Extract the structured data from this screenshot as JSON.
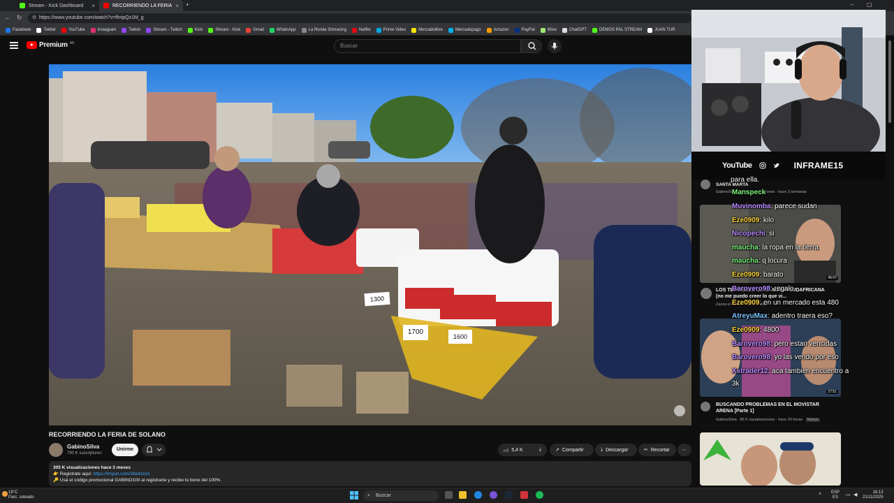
{
  "browser": {
    "tabs": [
      {
        "label": "Stream - Kick Dashboard",
        "active": false
      },
      {
        "label": "RECORRIENDO LA FERIA DE SOL...",
        "active": true
      }
    ],
    "url": "https://www.youtube.com/watch?v=fhripQz1M_g",
    "bookmarks": [
      {
        "label": "Facebook",
        "color": "#1877f2"
      },
      {
        "label": "Twitter",
        "color": "#ffffff"
      },
      {
        "label": "YouTube",
        "color": "#ff0000"
      },
      {
        "label": "Instagram",
        "color": "#e1306c"
      },
      {
        "label": "Twitch",
        "color": "#9146ff"
      },
      {
        "label": "Stream - Twitch",
        "color": "#9146ff"
      },
      {
        "label": "Kick",
        "color": "#53fc18"
      },
      {
        "label": "Stream - Kick",
        "color": "#53fc18"
      },
      {
        "label": "Gmail",
        "color": "#ea4335"
      },
      {
        "label": "WhatsApp",
        "color": "#25d366"
      },
      {
        "label": "La Ronda Simracing",
        "color": "#888888"
      },
      {
        "label": "Netflix",
        "color": "#e50914"
      },
      {
        "label": "Prime Video",
        "color": "#00a8e1"
      },
      {
        "label": "Mercadolibre",
        "color": "#ffe600"
      },
      {
        "label": "Mercadopago",
        "color": "#00b1ea"
      },
      {
        "label": "Amazon",
        "color": "#ff9900"
      },
      {
        "label": "PayPal",
        "color": "#003087"
      },
      {
        "label": "Wise",
        "color": "#9fe870"
      },
      {
        "label": "ChatGPT",
        "color": "#dddddd"
      },
      {
        "label": "DEMOS PAL STREAM",
        "color": "#53fc18"
      },
      {
        "label": "JUAN TUR",
        "color": "#ffffff"
      }
    ]
  },
  "yt": {
    "logo_text": "Premium",
    "logo_sup": "AR",
    "search_placeholder": "Buscar"
  },
  "video": {
    "title": "RECORRIENDO LA FERIA DE SOLANO",
    "channel": "GabinoSilva",
    "subscribers": "790 K suscriptores",
    "join_label": "Unirme",
    "likes": "5,4 K",
    "share_label": "Compartir",
    "download_label": "Descargar",
    "clip_label": "Recortar",
    "stats": "305 K visualizaciones  hace 3 meses",
    "desc_line1_prefix": "Registrate aquí: ",
    "desc_line1_link": "https://tinyurl.com/38e42e2x",
    "desc_line2": "Usá el código promocional GABINO100 al registrarte y recibe tu bono del 100%.",
    "price_tags": [
      "1300",
      "1700",
      "1600"
    ]
  },
  "stream_overlay": {
    "socials_brand": "YouTube",
    "handle": "INFRAME15"
  },
  "recommendations": [
    {
      "title_fragment": "SANTA MARTA",
      "meta": "GabinoSilva · 98 K visualizaciones · hace 3 semanas",
      "duration": "45:07"
    },
    {
      "title": "LOS TERRIBLES DE LA MAFIA SUDAFRICANA (no me puedo creer lo que vi...",
      "meta": "Zazza el italiano · hace 4 días"
    },
    {
      "title": "BUSCANDO PROBLEMAS EN EL MOVISTAR ARENA [Parte 1]",
      "meta": "GabinoSilva · 85 K visualizaciones · hace 20 horas",
      "badge": "Nuevo",
      "duration": "27:51"
    }
  ],
  "chat": [
    {
      "user": "",
      "text": "para ella.",
      "color": "white"
    },
    {
      "user": "Manspeck",
      "text": "",
      "color": "green"
    },
    {
      "user": "Muvinomba",
      "text": ": parece sudan",
      "color": "purple"
    },
    {
      "user": "Eze0909",
      "text": ": kilo",
      "color": "yellow"
    },
    {
      "user": "Nicopechi",
      "text": ": si",
      "color": "purple"
    },
    {
      "user": "maucha",
      "text": ": la ropa en la tierra",
      "color": "green"
    },
    {
      "user": "maucha",
      "text": ": q locura",
      "color": "green"
    },
    {
      "user": "Eze0909",
      "text": ": barato",
      "color": "yellow"
    },
    {
      "user": "Barovero98",
      "text": ": regalo",
      "color": "purple"
    },
    {
      "user": "Eze0909",
      "text": ": en un mercado esta 480",
      "color": "yellow"
    },
    {
      "user": "AtreyuMax",
      "text": ": adentro traera eso?",
      "color": "blue"
    },
    {
      "user": "Eze0909",
      "text": ": 4800",
      "color": "yellow"
    },
    {
      "user": "Barovero98",
      "text": ": pero estan vencidas",
      "color": "purple"
    },
    {
      "user": "Barovero98",
      "text": ": yo las vendo por eso",
      "color": "purple"
    },
    {
      "user": "Xstrader12",
      "text": ": aca tambien encuentro a",
      "color": "purple"
    },
    {
      "user": "",
      "text": "3k",
      "color": "white"
    }
  ],
  "taskbar": {
    "weather_temp": "18°C",
    "weather_desc": "Parc. soleado",
    "search_label": "Buscar",
    "lang_top": "ESP",
    "lang_bottom": "ES",
    "time": "16:13",
    "date": "21/11/2025"
  }
}
